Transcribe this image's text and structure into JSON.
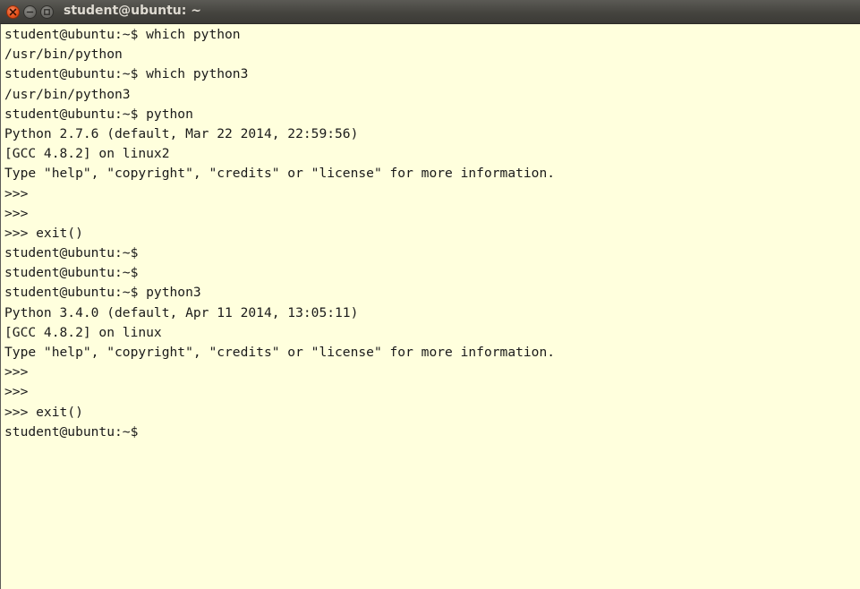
{
  "window": {
    "title": "student@ubuntu: ~",
    "close_icon": "close-icon",
    "minimize_icon": "minimize-icon",
    "maximize_icon": "maximize-icon"
  },
  "colors": {
    "terminal_background": "#ffffdd",
    "terminal_text": "#1a1a1a",
    "titlebar": "#45443f",
    "close_button": "#e9541d"
  },
  "terminal": {
    "lines": [
      "student@ubuntu:~$ which python",
      "/usr/bin/python",
      "student@ubuntu:~$ which python3",
      "/usr/bin/python3",
      "student@ubuntu:~$ python",
      "Python 2.7.6 (default, Mar 22 2014, 22:59:56)",
      "[GCC 4.8.2] on linux2",
      "Type \"help\", \"copyright\", \"credits\" or \"license\" for more information.",
      ">>>",
      ">>>",
      ">>> exit()",
      "student@ubuntu:~$",
      "student@ubuntu:~$",
      "student@ubuntu:~$ python3",
      "Python 3.4.0 (default, Apr 11 2014, 13:05:11)",
      "[GCC 4.8.2] on linux",
      "Type \"help\", \"copyright\", \"credits\" or \"license\" for more information.",
      ">>>",
      ">>>",
      ">>> exit()",
      "student@ubuntu:~$"
    ]
  }
}
